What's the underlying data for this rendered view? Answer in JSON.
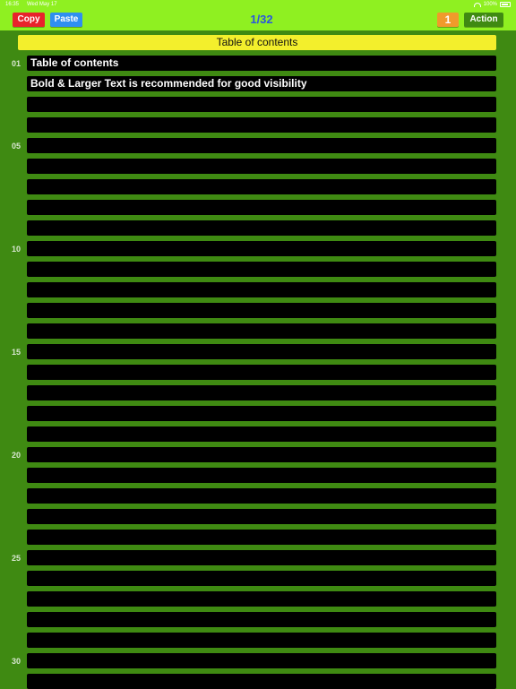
{
  "status": {
    "time": "16:35",
    "date": "Wed May 17",
    "battery": "100%"
  },
  "toolbar": {
    "copy_label": "Copy",
    "paste_label": "Paste",
    "page": "1/32",
    "count": "1",
    "action_label": "Action"
  },
  "header": {
    "title": "Table of contents"
  },
  "rows": [
    {
      "num": "01",
      "text": "Table of contents"
    },
    {
      "num": "",
      "text": "Bold & Larger Text is recommended for good visibility"
    },
    {
      "num": "",
      "text": ""
    },
    {
      "num": "",
      "text": ""
    },
    {
      "num": "05",
      "text": ""
    },
    {
      "num": "",
      "text": ""
    },
    {
      "num": "",
      "text": ""
    },
    {
      "num": "",
      "text": ""
    },
    {
      "num": "",
      "text": ""
    },
    {
      "num": "10",
      "text": ""
    },
    {
      "num": "",
      "text": ""
    },
    {
      "num": "",
      "text": ""
    },
    {
      "num": "",
      "text": ""
    },
    {
      "num": "",
      "text": ""
    },
    {
      "num": "15",
      "text": ""
    },
    {
      "num": "",
      "text": ""
    },
    {
      "num": "",
      "text": ""
    },
    {
      "num": "",
      "text": ""
    },
    {
      "num": "",
      "text": ""
    },
    {
      "num": "20",
      "text": ""
    },
    {
      "num": "",
      "text": ""
    },
    {
      "num": "",
      "text": ""
    },
    {
      "num": "",
      "text": ""
    },
    {
      "num": "",
      "text": ""
    },
    {
      "num": "25",
      "text": ""
    },
    {
      "num": "",
      "text": ""
    },
    {
      "num": "",
      "text": ""
    },
    {
      "num": "",
      "text": ""
    },
    {
      "num": "",
      "text": ""
    },
    {
      "num": "30",
      "text": ""
    },
    {
      "num": "",
      "text": ""
    }
  ]
}
